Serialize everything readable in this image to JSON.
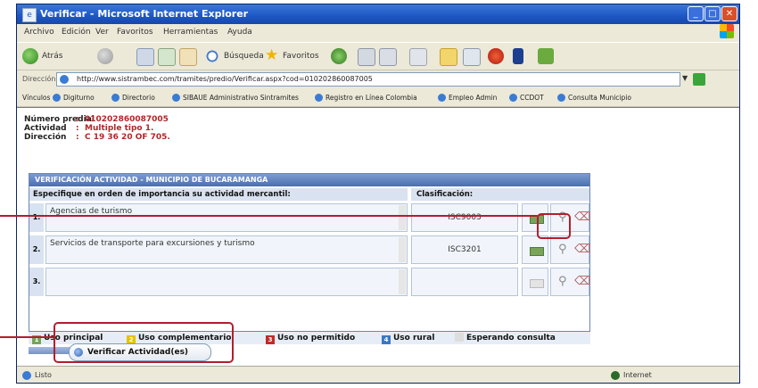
{
  "window": {
    "title": "Verificar - Microsoft Internet Explorer",
    "minimize": "_",
    "maximize": "□",
    "close": "✕"
  },
  "menu": [
    "Archivo",
    "Edición",
    "Ver",
    "Favoritos",
    "Herramientas",
    "Ayuda"
  ],
  "toolbar": {
    "back_label": "Atrás",
    "search_label": "Búsqueda",
    "favorites_label": "Favoritos"
  },
  "address": {
    "label": "Dirección",
    "url": "http://www.sistrambec.com/tramites/predio/Verificar.aspx?cod=010202860087005"
  },
  "links": [
    "Vínculos",
    "Digiturno",
    "Directorio",
    "SIBAUE Administrativo Sintramites",
    "Registro en Línea Colombia",
    "Empleo Admin",
    "CCDOT",
    "Consulta Municipio"
  ],
  "predio": {
    "numero_label": "Número predial",
    "numero_value": "010202860087005",
    "actividad_label": "Actividad",
    "actividad_value": "Multiple tipo 1.",
    "direccion_label": "Dirección",
    "direccion_value": "C 19 36 20 OF 705."
  },
  "panel": {
    "title": "VERIFICACIÓN ACTIVIDAD - MUNICIPIO DE BUCARAMANGA",
    "col_actividad": "Especifique en orden de importancia su actividad mercantil:",
    "col_clasificacion": "Clasificación:",
    "rows": [
      {
        "num": "1.",
        "text": "Agencias de turismo",
        "code": "ISC9003"
      },
      {
        "num": "2.",
        "text": "Servicios de transporte para excursiones y turismo",
        "code": "ISC3201"
      },
      {
        "num": "3.",
        "text": "",
        "code": ""
      }
    ]
  },
  "legend": {
    "items": [
      {
        "mark": "1",
        "label": "Uso principal",
        "color": "#7aa35a"
      },
      {
        "mark": "2",
        "label": "Uso complementario",
        "color": "#e6c200"
      },
      {
        "mark": "3",
        "label": "Uso no permitido",
        "color": "#c22a2a"
      },
      {
        "mark": "4",
        "label": "Uso rural",
        "color": "#3a78c6"
      },
      {
        "mark": "",
        "label": "Esperando consulta",
        "color": "#dddddd"
      }
    ]
  },
  "verify_button": {
    "label": "Verificar Actividad(es)"
  },
  "status": {
    "text": "Listo",
    "zone": "Internet"
  },
  "colors": {
    "callout": "#b21e2e",
    "predio_value": "#b3262a",
    "panel_header": "#4a6eb0"
  }
}
